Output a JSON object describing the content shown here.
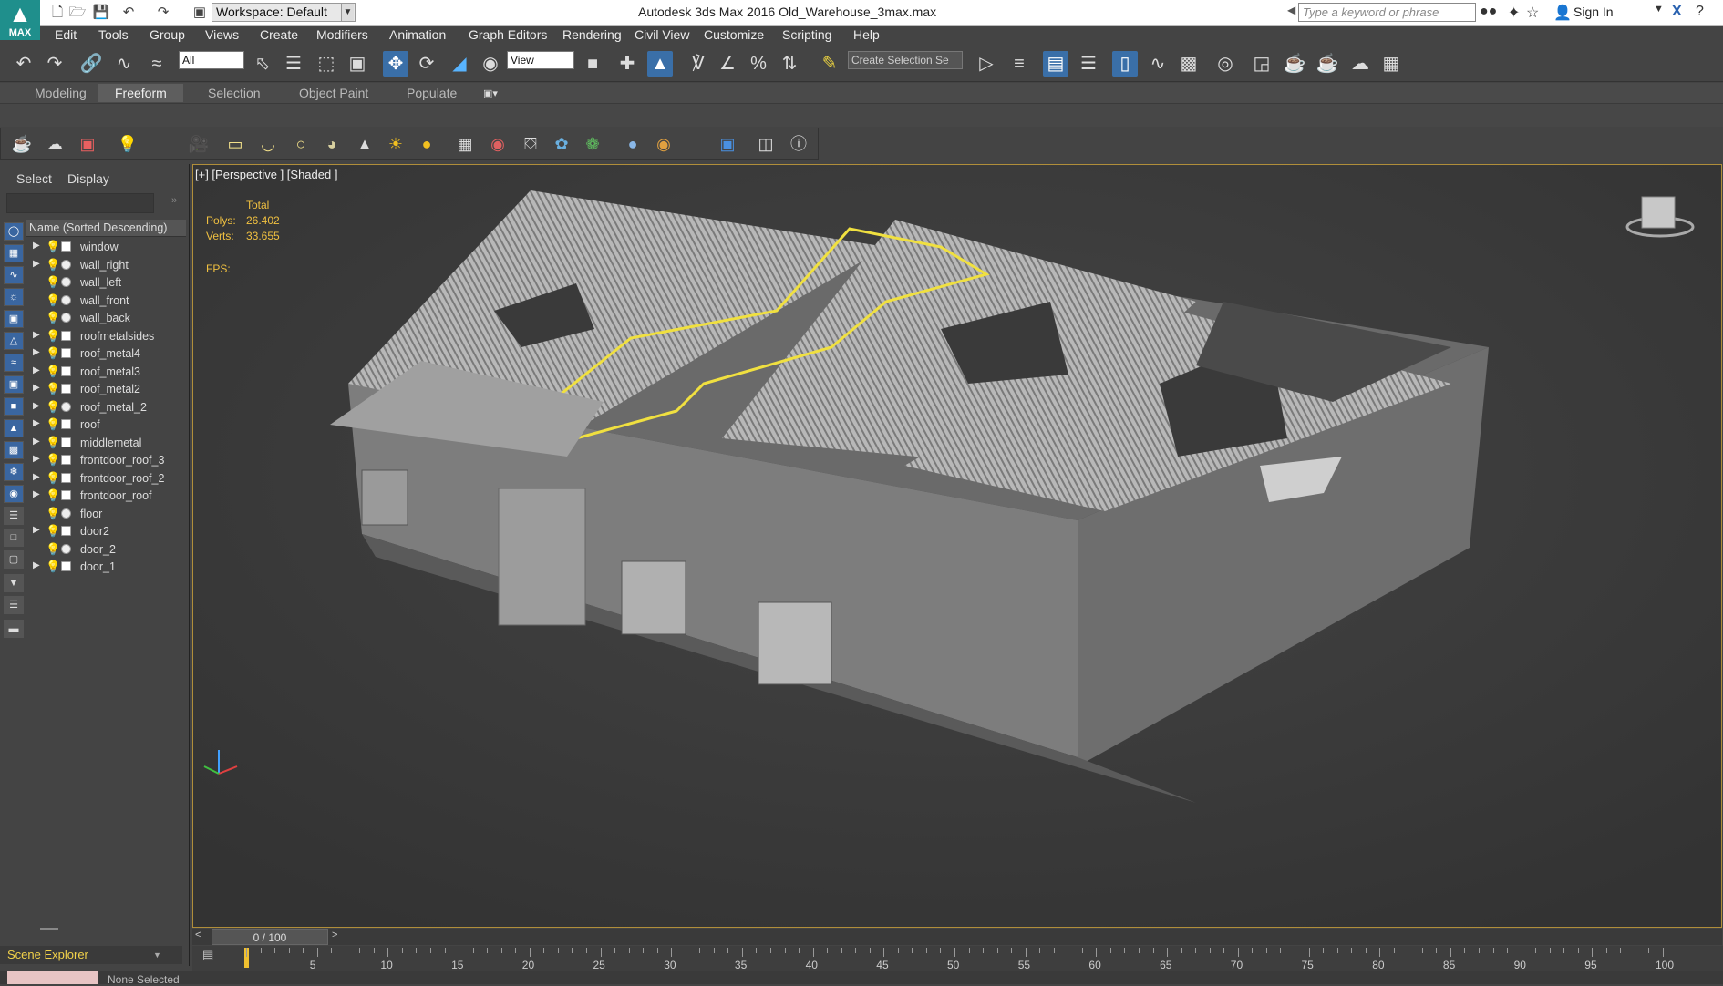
{
  "titlebar": {
    "app_logo": "MAX",
    "workspace": "Workspace: Default",
    "title": "Autodesk 3ds Max 2016    Old_Warehouse_3max.max",
    "search_placeholder": "Type a keyword or phrase",
    "sign_in": "Sign In"
  },
  "menu": [
    "Edit",
    "Tools",
    "Group",
    "Views",
    "Create",
    "Modifiers",
    "Animation",
    "Graph Editors",
    "Rendering",
    "Civil View",
    "Customize",
    "Scripting",
    "Help"
  ],
  "toolbar": {
    "filter_value": "All",
    "refcoord_value": "View",
    "selection_set_placeholder": "Create Selection Se"
  },
  "ribbon_tabs": [
    "Modeling",
    "Freeform",
    "Selection",
    "Object Paint",
    "Populate"
  ],
  "ribbon_active": "Freeform",
  "explorer": {
    "tabs": [
      "Select",
      "Display"
    ],
    "column_header": "Name (Sorted Descending)",
    "items": [
      {
        "label": "window",
        "expand": true,
        "round": false
      },
      {
        "label": "wall_right",
        "expand": true,
        "round": true
      },
      {
        "label": "wall_left",
        "expand": false,
        "round": true
      },
      {
        "label": "wall_front",
        "expand": false,
        "round": true
      },
      {
        "label": "wall_back",
        "expand": false,
        "round": true
      },
      {
        "label": "roofmetalsides",
        "expand": true,
        "round": false
      },
      {
        "label": "roof_metal4",
        "expand": true,
        "round": false
      },
      {
        "label": "roof_metal3",
        "expand": true,
        "round": false
      },
      {
        "label": "roof_metal2",
        "expand": true,
        "round": false
      },
      {
        "label": "roof_metal_2",
        "expand": true,
        "round": true
      },
      {
        "label": "roof",
        "expand": true,
        "round": false
      },
      {
        "label": "middlemetal",
        "expand": true,
        "round": false
      },
      {
        "label": "frontdoor_roof_3",
        "expand": true,
        "round": false
      },
      {
        "label": "frontdoor_roof_2",
        "expand": true,
        "round": false
      },
      {
        "label": "frontdoor_roof",
        "expand": true,
        "round": false
      },
      {
        "label": "floor",
        "expand": false,
        "round": true
      },
      {
        "label": "door2",
        "expand": true,
        "round": false
      },
      {
        "label": "door_2",
        "expand": false,
        "round": true
      },
      {
        "label": "door_1",
        "expand": true,
        "round": false
      }
    ],
    "footer": "Scene Explorer"
  },
  "viewport": {
    "label": "[+] [Perspective ] [Shaded ]",
    "stats_header": "Total",
    "polys_label": "Polys:",
    "polys_value": "26.402",
    "verts_label": "Verts:",
    "verts_value": "33.655",
    "fps_label": "FPS:"
  },
  "timeline": {
    "frame": "0 / 100",
    "ticks": [
      "5",
      "10",
      "15",
      "20",
      "25",
      "30",
      "35",
      "40",
      "45",
      "50",
      "55",
      "60",
      "65",
      "70",
      "75",
      "80",
      "85",
      "90",
      "95",
      "100"
    ]
  },
  "status": {
    "selection": "None Selected"
  }
}
